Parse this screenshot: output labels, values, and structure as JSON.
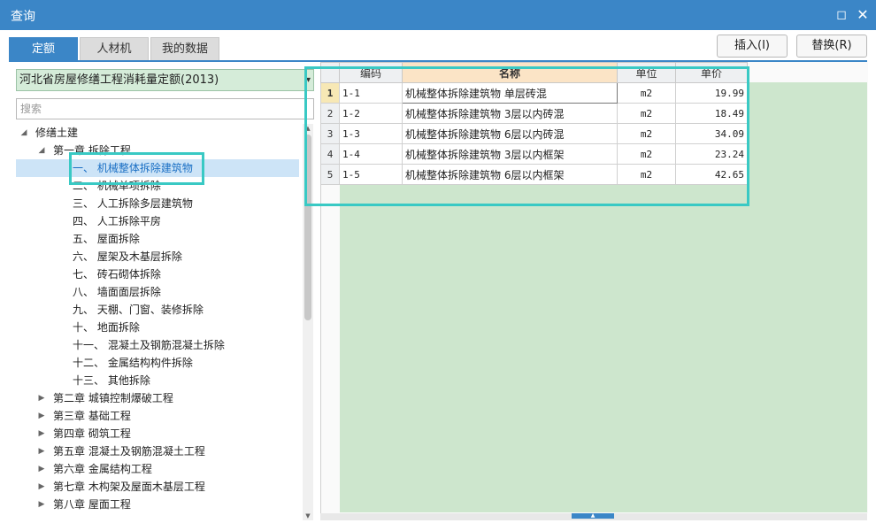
{
  "window": {
    "title": "查询"
  },
  "tabs": [
    {
      "label": "定额",
      "active": true
    },
    {
      "label": "人材机",
      "active": false
    },
    {
      "label": "我的数据",
      "active": false
    }
  ],
  "actions": {
    "insert_label": "插入(I)",
    "replace_label": "替换(R)"
  },
  "library_select": {
    "value": "河北省房屋修缮工程消耗量定额(2013)"
  },
  "search": {
    "placeholder": "搜索",
    "value": ""
  },
  "tree": {
    "root": "修缮土建",
    "chapter1": "第一章 拆除工程",
    "chapter1_items": [
      "一、 机械整体拆除建筑物",
      "二、 机械单项拆除",
      "三、 人工拆除多层建筑物",
      "四、 人工拆除平房",
      "五、 屋面拆除",
      "六、 屋架及木基层拆除",
      "七、 砖石砌体拆除",
      "八、 墙面面层拆除",
      "九、 天棚、门窗、装修拆除",
      "十、 地面拆除",
      "十一、 混凝土及钢筋混凝土拆除",
      "十二、 金属结构构件拆除",
      "十三、 其他拆除"
    ],
    "chapters": [
      "第二章 城镇控制爆破工程",
      "第三章 基础工程",
      "第四章 砌筑工程",
      "第五章 混凝土及钢筋混凝土工程",
      "第六章 金属结构工程",
      "第七章 木构架及屋面木基层工程",
      "第八章 屋面工程"
    ],
    "selected_index": 0
  },
  "grid": {
    "columns": {
      "code": "编码",
      "name": "名称",
      "unit": "单位",
      "price": "单价"
    },
    "rows": [
      {
        "no": "1",
        "code": "1-1",
        "name": "机械整体拆除建筑物 单层砖混",
        "unit": "m2",
        "price": "19.99"
      },
      {
        "no": "2",
        "code": "1-2",
        "name": "机械整体拆除建筑物 3层以内砖混",
        "unit": "m2",
        "price": "18.49"
      },
      {
        "no": "3",
        "code": "1-3",
        "name": "机械整体拆除建筑物 6层以内砖混",
        "unit": "m2",
        "price": "34.09"
      },
      {
        "no": "4",
        "code": "1-4",
        "name": "机械整体拆除建筑物 3层以内框架",
        "unit": "m2",
        "price": "23.24"
      },
      {
        "no": "5",
        "code": "1-5",
        "name": "机械整体拆除建筑物 6层以内框架",
        "unit": "m2",
        "price": "42.65"
      }
    ]
  },
  "colors": {
    "accent": "#3b86c7",
    "highlight": "#39c9c4",
    "grid_bg": "#cde6cd",
    "select_bg": "#d5ecd9"
  }
}
